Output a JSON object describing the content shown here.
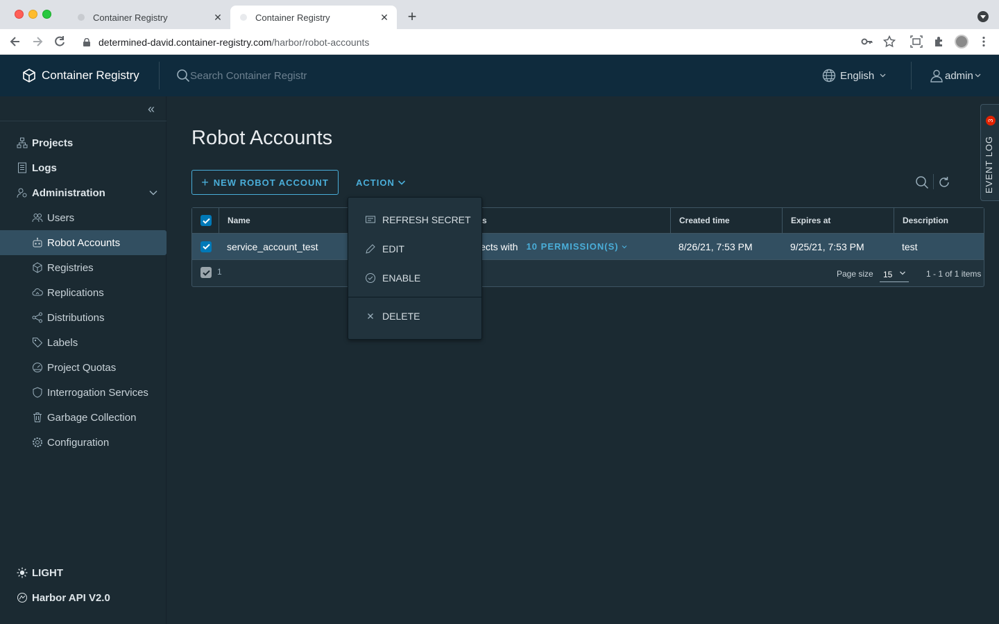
{
  "browser": {
    "tabs": [
      {
        "title": "Container Registry",
        "active": false
      },
      {
        "title": "Container Registry",
        "active": true
      }
    ],
    "close_glyph": "✕",
    "new_tab_glyph": "+",
    "url_host": "determined-david.container-registry.com",
    "url_path": "/harbor/robot-accounts"
  },
  "header": {
    "brand": "Container Registry",
    "search_placeholder": "Search Container Registr",
    "language": "English",
    "user": "admin"
  },
  "sidebar": {
    "collapse_glyph": "«",
    "items": [
      {
        "label": "Projects",
        "icon": "projects-icon",
        "level": "top"
      },
      {
        "label": "Logs",
        "icon": "logs-icon",
        "level": "top"
      },
      {
        "label": "Administration",
        "icon": "administration-icon",
        "level": "top",
        "expanded": true
      },
      {
        "label": "Users",
        "icon": "users-icon",
        "level": "sub"
      },
      {
        "label": "Robot Accounts",
        "icon": "robot-icon",
        "level": "sub",
        "selected": true
      },
      {
        "label": "Registries",
        "icon": "registries-icon",
        "level": "sub"
      },
      {
        "label": "Replications",
        "icon": "replications-icon",
        "level": "sub"
      },
      {
        "label": "Distributions",
        "icon": "distributions-icon",
        "level": "sub"
      },
      {
        "label": "Labels",
        "icon": "labels-icon",
        "level": "sub"
      },
      {
        "label": "Project Quotas",
        "icon": "quotas-icon",
        "level": "sub"
      },
      {
        "label": "Interrogation Services",
        "icon": "shield-icon",
        "level": "sub"
      },
      {
        "label": "Garbage Collection",
        "icon": "trash-icon",
        "level": "sub"
      },
      {
        "label": "Configuration",
        "icon": "gear-icon",
        "level": "sub"
      }
    ],
    "footer": [
      {
        "label": "LIGHT",
        "icon": "sun-icon"
      },
      {
        "label": "Harbor API V2.0",
        "icon": "api-icon"
      }
    ]
  },
  "main": {
    "title": "Robot Accounts",
    "new_button": "NEW ROBOT ACCOUNT",
    "new_button_plus": "+",
    "action_button": "ACTION",
    "columns": [
      "Name",
      "s",
      "Created time",
      "Expires at",
      "Description"
    ],
    "rows": [
      {
        "name": "service_account_test",
        "permissions_text": "jects with",
        "permissions_link": "10 PERMISSION(S)",
        "created": "8/26/21, 7:53 PM",
        "expires": "9/25/21, 7:53 PM",
        "description": "test"
      }
    ],
    "footer": {
      "selected_count": "1",
      "page_size_label": "Page size",
      "page_size": "15",
      "items_count": "1 - 1 of 1 items"
    }
  },
  "action_menu": {
    "items": [
      {
        "label": "REFRESH SECRET",
        "icon": "refresh-secret-icon"
      },
      {
        "label": "EDIT",
        "icon": "pencil-icon"
      },
      {
        "label": "ENABLE",
        "icon": "check-circle-icon"
      },
      {
        "label": "DELETE",
        "icon": "close-icon"
      }
    ]
  },
  "event_log": {
    "label": "EVENT LOG",
    "badge": "3"
  },
  "colors": {
    "accent": "#4aaed9",
    "header_bg": "#0f2b3d",
    "app_bg": "#1b2a32",
    "selected_bg": "#324f61",
    "badge": "#e12200"
  }
}
